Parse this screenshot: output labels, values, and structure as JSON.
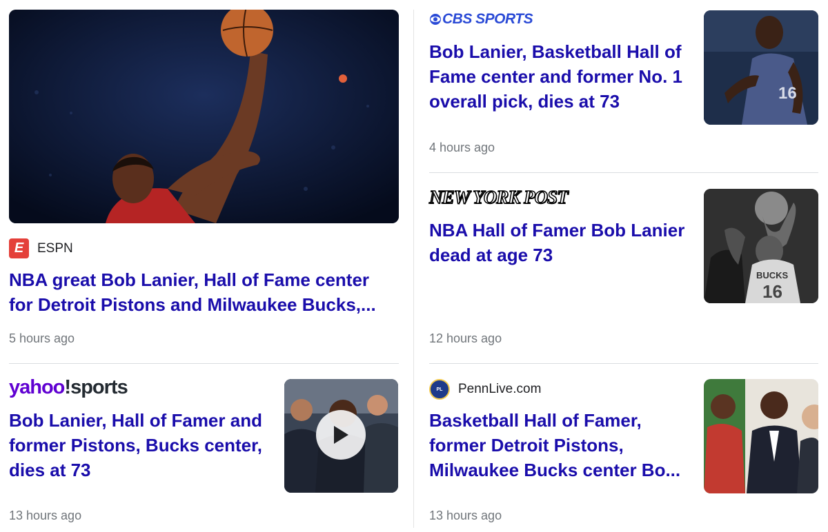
{
  "articles": [
    {
      "source": "ESPN",
      "headline": "NBA great Bob Lanier, Hall of Fame center for Detroit Pistons and Milwaukee Bucks,...",
      "time": "5 hours ago",
      "thumbnail": "player-shooting-photo"
    },
    {
      "source": "CBS SPORTS",
      "headline": "Bob Lanier, Basketball Hall of Fame center and former No. 1 overall pick, dies at 73",
      "time": "4 hours ago",
      "thumbnail": "pistons-16-photo"
    },
    {
      "source": "NEW YORK POST",
      "headline": "NBA Hall of Famer Bob Lanier dead at age 73",
      "time": "12 hours ago",
      "thumbnail": "bucks-16-bw-photo"
    },
    {
      "source": "yahoo!sports",
      "source_part1": "yahoo",
      "source_part2": "!sports",
      "headline": "Bob Lanier, Hall of Famer and former Pistons, Bucks center, dies at 73",
      "time": "13 hours ago",
      "thumbnail": "video-thumbnail",
      "play_icon": "play-icon"
    },
    {
      "source": "PennLive.com",
      "headline": "Basketball Hall of Famer, former Detroit Pistons, Milwaukee Bucks center Bo...",
      "time": "13 hours ago",
      "thumbnail": "group-photo"
    }
  ],
  "colors": {
    "headline": "#1a0dab",
    "time": "#70757a",
    "espn": "#e4403a",
    "cbs": "#2a4ad6",
    "yahoo": "#6001d2"
  }
}
